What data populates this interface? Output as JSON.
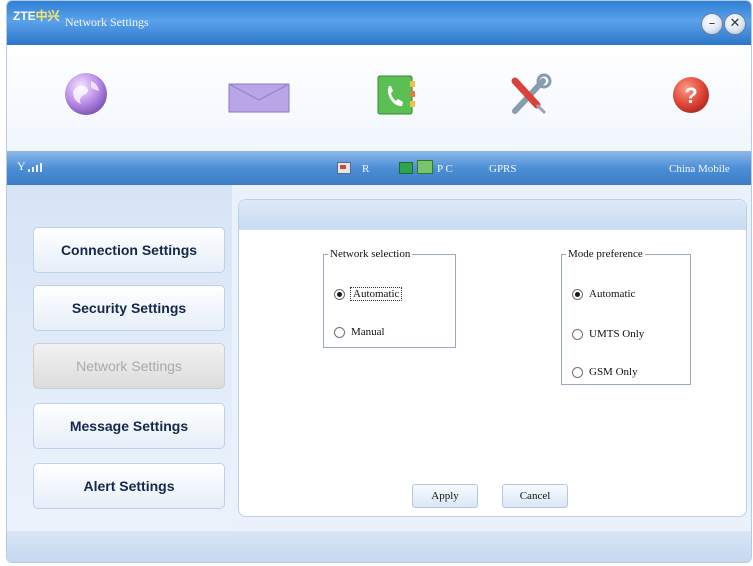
{
  "window": {
    "brand_latin": "ZTE",
    "brand_cn": "中兴",
    "title": "Network Settings",
    "minimize_glyph": "–",
    "close_glyph": "✕"
  },
  "toolbar": {
    "items": [
      {
        "icon": "globe-icon"
      },
      {
        "icon": "envelope-icon"
      },
      {
        "icon": "phonebook-icon"
      },
      {
        "icon": "tools-icon"
      },
      {
        "icon": "help-icon"
      }
    ]
  },
  "status": {
    "signal_label": "Y",
    "roaming": "R",
    "pc": "P C",
    "network_type": "GPRS",
    "operator": "China Mobile"
  },
  "sidebar": {
    "items": [
      {
        "label": "Connection Settings",
        "active": false
      },
      {
        "label": "Security Settings",
        "active": false
      },
      {
        "label": "Network Settings",
        "active": true
      },
      {
        "label": "Message Settings",
        "active": false
      },
      {
        "label": "Alert Settings",
        "active": false
      }
    ]
  },
  "network_selection": {
    "legend": "Network selection",
    "options": [
      {
        "label": "Automatic",
        "selected": true
      },
      {
        "label": "Manual",
        "selected": false
      }
    ]
  },
  "mode_preference": {
    "legend": "Mode preference",
    "options": [
      {
        "label": "Automatic",
        "selected": true
      },
      {
        "label": "UMTS Only",
        "selected": false
      },
      {
        "label": "GSM Only",
        "selected": false
      }
    ]
  },
  "actions": {
    "apply": "Apply",
    "cancel": "Cancel"
  },
  "colors": {
    "title_bar": "#3a86d8",
    "status_bar": "#4d8fd6",
    "help_red": "#e14b3b"
  }
}
